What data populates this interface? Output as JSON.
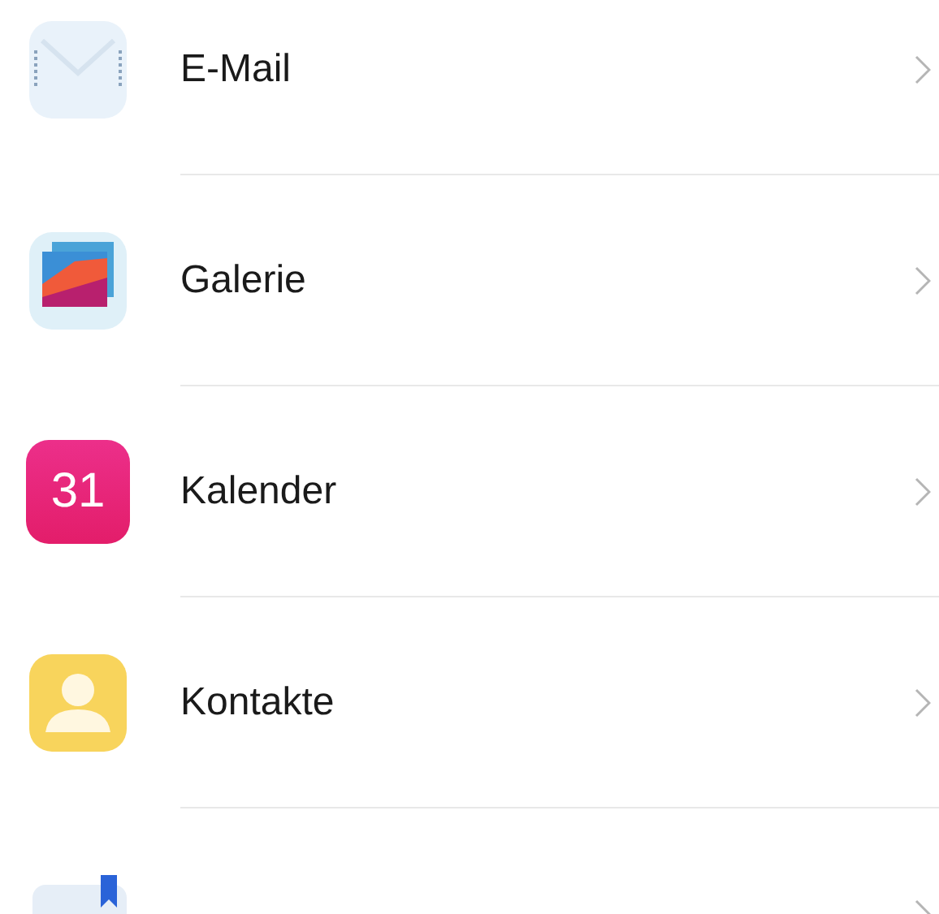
{
  "items": [
    {
      "kind": "mail",
      "label": "E-Mail"
    },
    {
      "kind": "gallery",
      "label": "Galerie"
    },
    {
      "kind": "calendar",
      "icon_text": "31",
      "label": "Kalender"
    },
    {
      "kind": "contacts",
      "label": "Kontakte"
    },
    {
      "kind": "notes"
    }
  ]
}
